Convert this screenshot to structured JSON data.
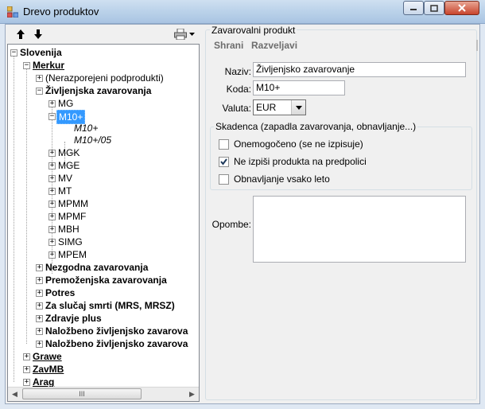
{
  "window": {
    "title": "Drevo produktov",
    "controls": [
      "minimize-icon",
      "maximize-icon",
      "close-icon"
    ]
  },
  "left_toolbar": {
    "icons": [
      "arrow-up-icon",
      "arrow-down-icon",
      "printer-icon",
      "dropdown-arrow-icon"
    ]
  },
  "tree": {
    "root": "Slovenija",
    "merkur": "Merkur",
    "unassigned": "(Nerazporejeni podprodukti)",
    "life": "Življenjska zavarovanja",
    "life_items": [
      "MG",
      "M10+",
      "MGK",
      "MGE",
      "MV",
      "MT",
      "MPMM",
      "MPMF",
      "MBH",
      "SIMG",
      "MPEM"
    ],
    "m10_children": [
      "M10+",
      "M10+/05"
    ],
    "merkur_groups": [
      "Nezgodna zavarovanja",
      "Premoženjska zavarovanja",
      "Potres",
      "Za slučaj smrti (MRS, MRSZ)",
      "Zdravje plus",
      "Naložbeno življenjsko zavarova",
      "Naložbeno življenjsko zavarova"
    ],
    "companies": [
      "Grawe",
      "ZavMB",
      "Arag"
    ],
    "selected": "M10+",
    "scroll_thumb_grip": "III"
  },
  "product": {
    "group_title": "Zavarovalni produkt",
    "save_label": "Shrani",
    "discard_label": "Razveljavi",
    "naziv_label": "Naziv:",
    "naziv_value": "Življenjsko zavarovanje",
    "koda_label": "Koda:",
    "koda_value": "M10+",
    "valuta_label": "Valuta:",
    "valuta_value": "EUR",
    "expiry_group_title": "Skadenca (zapadla zavarovanja, obnavljanje...)",
    "checkboxes": [
      {
        "label": "Onemogočeno (se ne izpisuje)",
        "checked": false
      },
      {
        "label": "Ne izpiši produkta na predpolici",
        "checked": true
      },
      {
        "label": "Obnavljanje vsako leto",
        "checked": false
      }
    ],
    "notes_label": "Opombe:",
    "notes_value": ""
  }
}
